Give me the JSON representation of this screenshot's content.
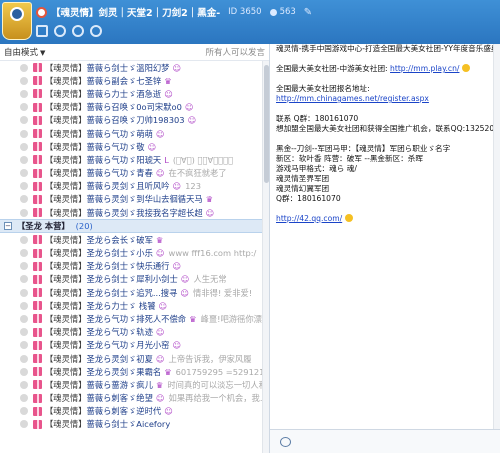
{
  "header": {
    "title": "【魂灵情】剑灵｜天堂2｜刀剑2｜黑金-",
    "id_label": "ID 3650",
    "member_count": "563",
    "edit_symbol": "✎"
  },
  "mode_bar": {
    "mode": "自由模式",
    "hint": "所有人可以发言"
  },
  "colors": {
    "header": "#2f80cc",
    "accent": "#1a44c8",
    "name": "#1f3f8a"
  },
  "members_top": [
    {
      "pre": "【魂灵情】",
      "name": "蔷薇ら剑士ゞ溫阳幻梦",
      "emo": "☺",
      "sig": ""
    },
    {
      "pre": "【魂灵情】",
      "name": "蔷薇ら副会ゞ七圣锌",
      "emo": "♛",
      "sig": ""
    },
    {
      "pre": "【魂灵情】",
      "name": "蔷薇ら力士ゞ酒急逝",
      "emo": "☺",
      "sig": ""
    },
    {
      "pre": "【魂灵情】",
      "name": "蔷薇ら召唤ゞ0o司宋默o0",
      "emo": "☺",
      "sig": ""
    },
    {
      "pre": "【魂灵情】",
      "name": "蔷薇ら召唤ゞ刀帅198303",
      "emo": "☺",
      "sig": ""
    },
    {
      "pre": "【魂灵情】",
      "name": "蔷薇ら气功ゞ萌萌",
      "emo": "☺",
      "sig": ""
    },
    {
      "pre": "【魂灵情】",
      "name": "蔷薇ら气功ゞ敬",
      "emo": "☺",
      "sig": ""
    },
    {
      "pre": "【魂灵情】",
      "name": "蔷薇ら气功ゞ阳琥天",
      "emo": "L",
      "sig": "(ﾟ∀ﾟ) 〈ﾟ∀ﾟ〉（ﾟ"
    },
    {
      "pre": "【魂灵情】",
      "name": "蔷薇ら气功ゞ青春",
      "emo": "☺",
      "sig": "在不疯狂就老了"
    },
    {
      "pre": "【魂灵情】",
      "name": "蔷薇ら灵剑ゞ且听风吟",
      "emo": "☺",
      "sig": "123"
    },
    {
      "pre": "【魂灵情】",
      "name": "蔷薇ら灵剑ゞ到华山去徊循天马",
      "emo": "♛",
      "sig": ""
    },
    {
      "pre": "【魂灵情】",
      "name": "蔷薇ら灵剑ゞ我接我名字超长超",
      "emo": "☺",
      "sig": ""
    }
  ],
  "group": {
    "toggle": "−",
    "name": "【圣龙 本营】",
    "count": "(20)"
  },
  "members_bottom": [
    {
      "pre": "【魂灵情】",
      "name": "圣龙ら会长ゞ破军",
      "emo": "♛",
      "sig": ""
    },
    {
      "pre": "【魂灵情】",
      "name": "圣龙ら剑士ゞ小乐",
      "emo": "☺",
      "sig": "www fff16.com  http:/"
    },
    {
      "pre": "【魂灵情】",
      "name": "圣龙ら剑士ゞ快乐通行",
      "emo": "☺",
      "sig": ""
    },
    {
      "pre": "【魂灵情】",
      "name": "圣龙ら剑士ゞ犀利小剑士",
      "emo": "☺",
      "sig": "人生无常"
    },
    {
      "pre": "【魂灵情】",
      "name": "圣龙ら剑士ゞ追咒...搜寻",
      "emo": "☺",
      "sig": "情非得! 爱非爱!"
    },
    {
      "pre": "【魂灵情】",
      "name": "圣龙ら力士ゞ 栈饕",
      "emo": "☺",
      "sig": ""
    },
    {
      "pre": "【魂灵情】",
      "name": "圣龙ら气功ゞ排死人不偿命",
      "emo": "♛",
      "sig": "峰噩!吧游徭你漂"
    },
    {
      "pre": "【魂灵情】",
      "name": "圣龙ら气功ゞ轨迹",
      "emo": "☺",
      "sig": ""
    },
    {
      "pre": "【魂灵情】",
      "name": "圣龙ら气功ゞ月光小窑",
      "emo": "☺",
      "sig": ""
    },
    {
      "pre": "【魂灵情】",
      "name": "圣龙ら灵剑ゞ初夏",
      "emo": "☺",
      "sig": "上帝告诉我，伊家风履"
    },
    {
      "pre": "【魂灵情】",
      "name": "圣龙ら灵剑ゞ果霸名",
      "emo": "♛",
      "sig": "601759295  =5291212"
    },
    {
      "pre": "【魂灵情】",
      "name": "蔷薇ら蔷游ゞ疯儿",
      "emo": "♛",
      "sig": "时间真的可以淡忘一切人和事"
    },
    {
      "pre": "【魂灵情】",
      "name": "蔷薇ら刺客ゞ绝望",
      "emo": "☺",
      "sig": "如果再给我一个机会，我..."
    },
    {
      "pre": "【魂灵情】",
      "name": "蔷薇ら刺客ゞ逆时代",
      "emo": "☺",
      "sig": ""
    },
    {
      "pre": "【魂灵情】",
      "name": "蔷薇ら剑士ゞAicefory",
      "emo": "",
      "sig": ""
    }
  ],
  "notice": {
    "l1": "魂灵情-携手中国游戏中心-打造全国最大美女社团-YY年度音乐盛典",
    "l2": "全国最大美女社团-中游美女社团:",
    "l2_link": "http://mm.play.cn/",
    "l3": "全国最大美女社团报名地址:",
    "l3_link": "http://mm.chinagames.net/register.aspx",
    "l4": "联系 Q群：180161070",
    "l5": "想加盟全国最大美女社团和获得全国推广机会，联系QQ:1325207588",
    "l6": "黑金--刀剑--军团马甲：【魂灵情】军团ら职业ゞ名字",
    "l7": "新区：软叶香 阵营：破军 --黑金新区：杀晖",
    "l8": "游戏马甲格式：魂ら  魂/",
    "l9": "魂灵情圣界军团",
    "l10": "魂灵情幻翼军团",
    "l11": "Q群：180161070",
    "l12_link": "http://42.qq.com/"
  }
}
